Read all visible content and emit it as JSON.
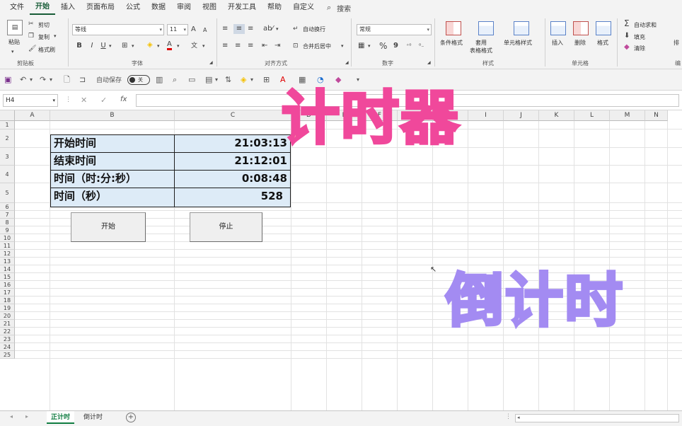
{
  "menu": {
    "items": [
      "文件",
      "开始",
      "插入",
      "页面布局",
      "公式",
      "数据",
      "审阅",
      "视图",
      "开发工具",
      "帮助",
      "自定义"
    ],
    "active_index": 1,
    "search_label": "搜索"
  },
  "ribbon": {
    "clipboard": {
      "paste": "粘贴",
      "cut": "剪切",
      "copy": "复制",
      "format_painter": "格式刷",
      "label": "剪贴板"
    },
    "font": {
      "name": "等线",
      "size": "11",
      "label": "字体",
      "bold": "B",
      "italic": "I",
      "underline": "U",
      "grow": "A",
      "shrink": "A",
      "color_letter": "A"
    },
    "alignment": {
      "wrap": "自动换行",
      "merge": "合并后居中",
      "label": "对齐方式"
    },
    "number": {
      "format": "常规",
      "label": "数字",
      "percent": "%",
      "comma": "9"
    },
    "styles": {
      "conditional": "条件格式",
      "table_format": "套用\n表格格式",
      "cell_style": "单元格样式",
      "label": "样式"
    },
    "cells": {
      "insert": "插入",
      "delete": "删除",
      "format": "格式",
      "label": "单元格"
    },
    "editing": {
      "autosum": "自动求和",
      "fill": "填充",
      "clear": "清除",
      "label": "编",
      "sort": "排"
    }
  },
  "qat": {
    "autosave_label": "自动保存",
    "autosave_state": "关"
  },
  "formula_bar": {
    "name_box": "H4",
    "fx": "fx",
    "cancel": "✕",
    "confirm": "✓"
  },
  "grid": {
    "columns": [
      "A",
      "B",
      "C",
      "D",
      "E",
      "F",
      "G",
      "H",
      "I",
      "J",
      "K",
      "L",
      "M",
      "N"
    ],
    "rows": [
      "1",
      "2",
      "3",
      "4",
      "5",
      "6",
      "7",
      "8",
      "9",
      "10",
      "11",
      "12",
      "13",
      "14",
      "15",
      "16",
      "17",
      "18",
      "19",
      "20",
      "21",
      "22",
      "23",
      "24",
      "25"
    ]
  },
  "table": [
    {
      "label": "开始时间",
      "value": "21:03:13"
    },
    {
      "label": "结束时间",
      "value": "21:12:01"
    },
    {
      "label": "时间（时:分:秒）",
      "value": "0:08:48"
    },
    {
      "label": "时间（秒）",
      "value": "528"
    }
  ],
  "buttons": {
    "start": "开始",
    "stop": "停止"
  },
  "overlays": {
    "timer": "计时器",
    "countdown": "倒计时"
  },
  "sheets": {
    "tabs": [
      "正计时",
      "倒计时"
    ],
    "active_index": 0,
    "add": "+"
  }
}
